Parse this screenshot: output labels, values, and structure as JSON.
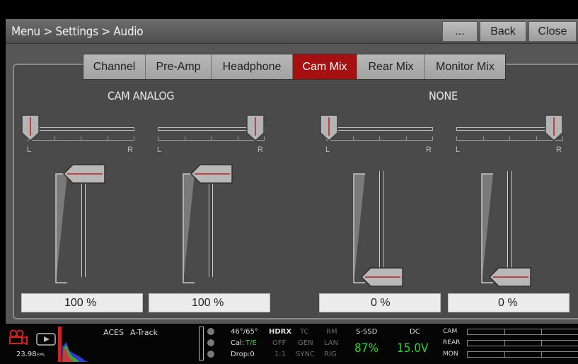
{
  "header": {
    "breadcrumb": "Menu > Settings > Audio",
    "more_label": "...",
    "back_label": "Back",
    "close_label": "Close"
  },
  "tabs": [
    {
      "label": "Channel",
      "active": false
    },
    {
      "label": "Pre-Amp",
      "active": false
    },
    {
      "label": "Headphone",
      "active": false
    },
    {
      "label": "Cam Mix",
      "active": true
    },
    {
      "label": "Rear Mix",
      "active": false
    },
    {
      "label": "Monitor Mix",
      "active": false
    }
  ],
  "mix": {
    "source_left": "CAM ANALOG",
    "source_right": "NONE",
    "pan_left_label": "L",
    "pan_right_label": "R",
    "channels": [
      {
        "pan": "L",
        "level_percent": 100,
        "level_text": "100 %"
      },
      {
        "pan": "R",
        "level_percent": 100,
        "level_text": "100 %"
      },
      {
        "pan": "L",
        "level_percent": 0,
        "level_text": "0 %"
      },
      {
        "pan": "R",
        "level_percent": 0,
        "level_text": "0 %"
      }
    ]
  },
  "status": {
    "fps": "23.98",
    "fps_unit": "FPS",
    "look": "ACES",
    "audio_track": "A-Track",
    "temperature": "46°/65°",
    "cal_label": "Cal:",
    "cal_value": "T/E",
    "drop": "Drop:0",
    "hdrx": "HDRX",
    "hdrx_value": "OFF",
    "ratio": "1:1",
    "tc": "TC",
    "tc_gen": "GEN",
    "tc_sync": "SYNC",
    "rm": "RM",
    "rm_lan": "LAN",
    "rm_rig": "RIG",
    "media_label": "S-SSD",
    "media_value": "87%",
    "power_label": "DC",
    "power_value": "15.0V",
    "meter_cam": "CAM",
    "meter_rear": "REAR",
    "meter_mon": "MON"
  },
  "colors": {
    "active_tab": "#a51010",
    "status_green": "#28d828",
    "record_red": "#d81e1e"
  }
}
